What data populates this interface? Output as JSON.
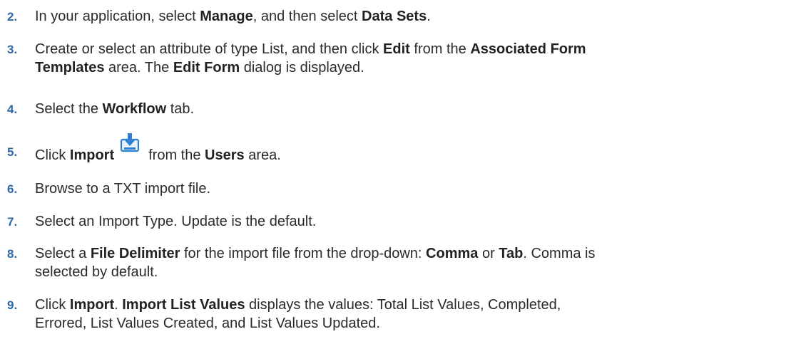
{
  "steps": [
    {
      "number": "2.",
      "parts": [
        {
          "t": "In your application, select ",
          "b": false
        },
        {
          "t": "Manage",
          "b": true
        },
        {
          "t": ", and then select ",
          "b": false
        },
        {
          "t": "Data Sets",
          "b": true
        },
        {
          "t": ".",
          "b": false
        }
      ]
    },
    {
      "number": "3.",
      "parts": [
        {
          "t": "Create or select an attribute of type List, and then click ",
          "b": false
        },
        {
          "t": "Edit",
          "b": true
        },
        {
          "t": " from the ",
          "b": false
        },
        {
          "t": "Associated Form",
          "b": true
        }
      ],
      "parts2": [
        {
          "t": "Templates",
          "b": true
        },
        {
          "t": " area. The ",
          "b": false
        },
        {
          "t": "Edit Form",
          "b": true
        },
        {
          "t": " dialog is displayed.",
          "b": false
        }
      ]
    },
    {
      "number": "4.",
      "parts": [
        {
          "t": "Select the ",
          "b": false
        },
        {
          "t": "Workflow",
          "b": true
        },
        {
          "t": " tab.",
          "b": false
        }
      ]
    },
    {
      "number": "5.",
      "before_icon": [
        {
          "t": "Click ",
          "b": false
        },
        {
          "t": "Import",
          "b": true
        }
      ],
      "icon": "import-icon",
      "after_icon": [
        {
          "t": "from the ",
          "b": false
        },
        {
          "t": "Users",
          "b": true
        },
        {
          "t": " area.",
          "b": false
        }
      ]
    },
    {
      "number": "6.",
      "parts": [
        {
          "t": "Browse to a TXT import file.",
          "b": false
        }
      ]
    },
    {
      "number": "7.",
      "parts": [
        {
          "t": "Select an Import Type. Update is the default.",
          "b": false
        }
      ]
    },
    {
      "number": "8.",
      "parts": [
        {
          "t": "Select a ",
          "b": false
        },
        {
          "t": "File Delimiter",
          "b": true
        },
        {
          "t": " for the import file from the drop-down: ",
          "b": false
        },
        {
          "t": "Comma",
          "b": true
        },
        {
          "t": " or ",
          "b": false
        },
        {
          "t": "Tab",
          "b": true
        },
        {
          "t": ". Comma is",
          "b": false
        }
      ],
      "parts2": [
        {
          "t": "selected by default.",
          "b": false
        }
      ]
    },
    {
      "number": "9.",
      "parts": [
        {
          "t": "Click ",
          "b": false
        },
        {
          "t": "Import",
          "b": true
        },
        {
          "t": ". ",
          "b": false
        },
        {
          "t": "Import List Values",
          "b": true
        },
        {
          "t": " displays the values: Total List Values, Completed,",
          "b": false
        }
      ],
      "parts2": [
        {
          "t": "Errored, List Values Created, and List Values Updated.",
          "b": false
        }
      ]
    }
  ],
  "colors": {
    "step_number": "#2e67a6",
    "body_text": "#2a2a2a",
    "icon_blue": "#2f7fd0"
  }
}
